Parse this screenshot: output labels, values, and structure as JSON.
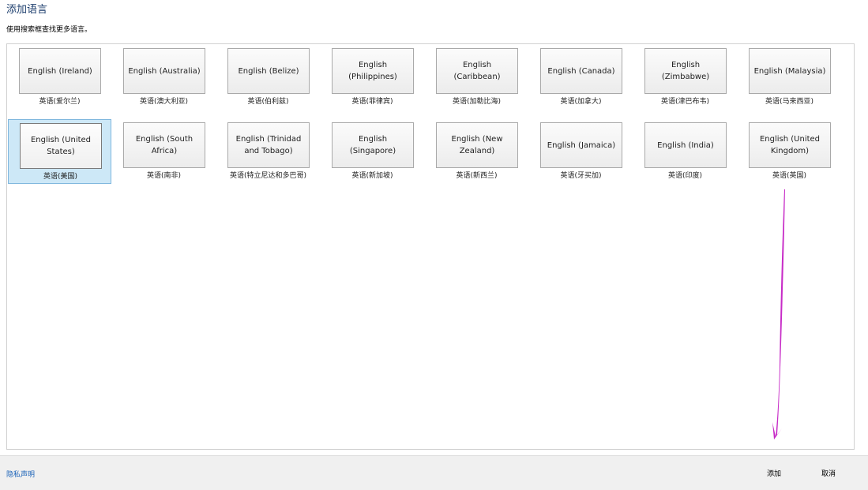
{
  "dialog": {
    "title": "添加语言",
    "instruction": "使用搜索框查找更多语言。"
  },
  "languages": [
    {
      "name": "English (Ireland)",
      "native": "英语(爱尔兰)",
      "selected": false
    },
    {
      "name": "English (Australia)",
      "native": "英语(澳大利亚)",
      "selected": false
    },
    {
      "name": "English (Belize)",
      "native": "英语(伯利兹)",
      "selected": false
    },
    {
      "name": "English (Philippines)",
      "native": "英语(菲律宾)",
      "selected": false
    },
    {
      "name": "English (Caribbean)",
      "native": "英语(加勒比海)",
      "selected": false
    },
    {
      "name": "English (Canada)",
      "native": "英语(加拿大)",
      "selected": false
    },
    {
      "name": "English (Zimbabwe)",
      "native": "英语(津巴布韦)",
      "selected": false
    },
    {
      "name": "English (Malaysia)",
      "native": "英语(马来西亚)",
      "selected": false
    },
    {
      "name": "English (United States)",
      "native": "英语(美国)",
      "selected": true
    },
    {
      "name": "English (South Africa)",
      "native": "英语(南非)",
      "selected": false
    },
    {
      "name": "English (Trinidad and Tobago)",
      "native": "英语(特立尼达和多巴哥)",
      "selected": false
    },
    {
      "name": "English (Singapore)",
      "native": "英语(新加坡)",
      "selected": false
    },
    {
      "name": "English (New Zealand)",
      "native": "英语(新西兰)",
      "selected": false
    },
    {
      "name": "English (Jamaica)",
      "native": "英语(牙买加)",
      "selected": false
    },
    {
      "name": "English (India)",
      "native": "英语(印度)",
      "selected": false
    },
    {
      "name": "English (United Kingdom)",
      "native": "英语(英国)",
      "selected": false
    }
  ],
  "footer": {
    "privacy_link": "隐私声明",
    "add_label": "添加",
    "cancel_label": "取消"
  },
  "colors": {
    "title": "#1e3f6e",
    "selection_fill": "#cde8f7",
    "selection_border": "#7fb7de",
    "link": "#1a62b8",
    "annotation_arrow": "#c72bc7"
  }
}
